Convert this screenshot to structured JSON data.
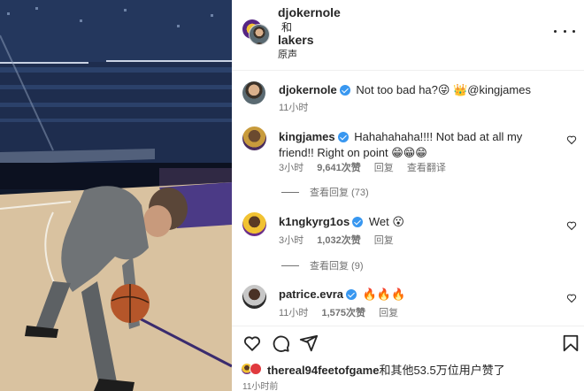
{
  "header": {
    "user1": "djokernole",
    "joiner": "和",
    "user2": "lakers",
    "audio": "原声"
  },
  "caption": {
    "user": "djokernole",
    "text": "Not too bad ha?😜 👑@kingjames",
    "time": "11小时"
  },
  "comments": [
    {
      "user": "kingjames",
      "text": "Hahahahaha!!!! Not bad at all my friend!! Right on point 😁😁😁",
      "time": "3小时",
      "likes": "9,641次赞",
      "reply": "回复",
      "translate": "查看翻译",
      "view_replies": "查看回复 (73)"
    },
    {
      "user": "k1ngkyrg1os",
      "text": "Wet 😮",
      "time": "3小时",
      "likes": "1,032次赞",
      "reply": "回复",
      "view_replies": "查看回复 (9)"
    },
    {
      "user": "patrice.evra",
      "text": "🔥🔥🔥",
      "time": "11小时",
      "likes": "1,575次赞",
      "reply": "回复"
    }
  ],
  "likes": {
    "user": "thereal94feetofgame",
    "rest": "和其他53.5万位用户赞了"
  },
  "post_time": "11小时前",
  "icons": [
    "heart-icon",
    "comment-icon",
    "share-icon",
    "bookmark-icon",
    "more-icon",
    "verified-icon"
  ],
  "colors": {
    "verified": "#3897f0",
    "text": "#262626",
    "muted": "#737373"
  }
}
